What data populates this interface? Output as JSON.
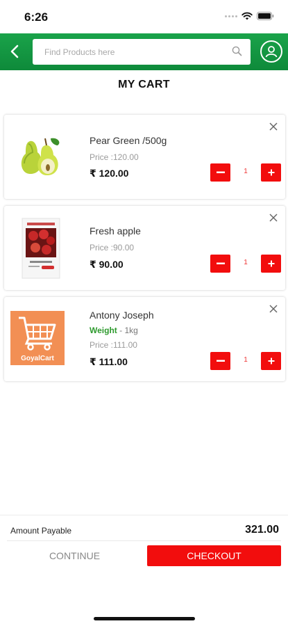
{
  "status_bar": {
    "time": "6:26"
  },
  "header": {
    "search_placeholder": "Find Products here",
    "brand_color": "#1aa34a"
  },
  "page": {
    "title": "MY CART"
  },
  "cart": {
    "items": [
      {
        "name": "Pear Green /500g",
        "weight_label": "",
        "weight_value": "",
        "price_label": "Price :120.00",
        "total": "₹ 120.00",
        "quantity": "1",
        "image": "pear-image"
      },
      {
        "name": "Fresh apple",
        "weight_label": "",
        "weight_value": "",
        "price_label": "Price :90.00",
        "total": "₹ 90.00",
        "quantity": "1",
        "image": "apple-pack-image"
      },
      {
        "name": "Antony Joseph",
        "weight_label": "Weight",
        "weight_value": " - 1kg",
        "price_label": "Price :111.00",
        "total": "₹ 111.00",
        "quantity": "1",
        "image": "goyalcart-logo",
        "logo_text": "GoyalCart"
      }
    ]
  },
  "summary": {
    "amount_label": "Amount Payable",
    "amount_value": "321.00",
    "continue_label": "CONTINUE",
    "checkout_label": "CHECKOUT"
  },
  "colors": {
    "accent_red": "#f20d0d",
    "weight_green": "#2e9a2e"
  },
  "icons": [
    "back-arrow-icon",
    "search-icon",
    "profile-icon",
    "close-icon",
    "minus-icon",
    "plus-icon",
    "wifi-icon",
    "battery-icon"
  ]
}
